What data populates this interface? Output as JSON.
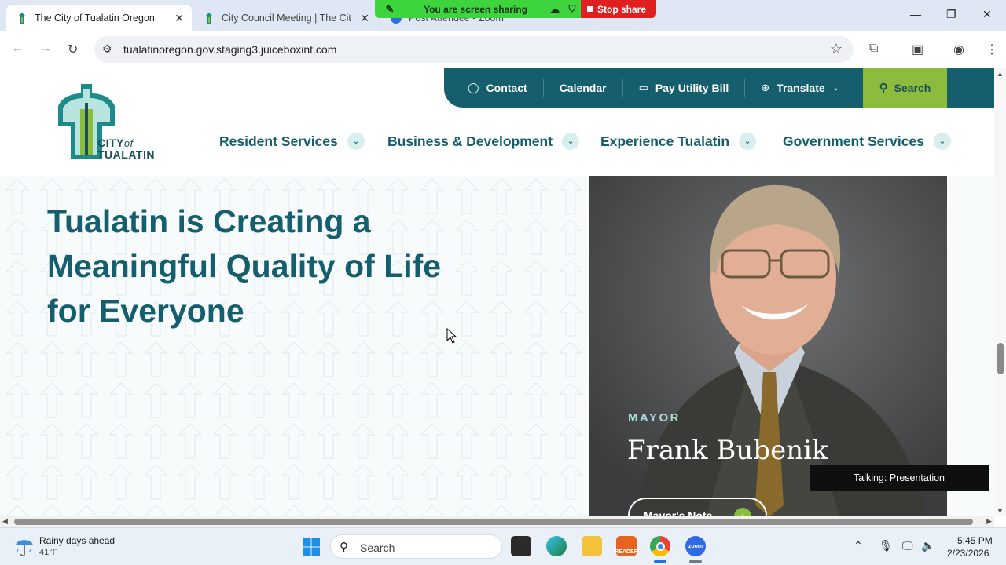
{
  "browser": {
    "tabs": [
      {
        "label": "The City of Tualatin Oregon",
        "active": true
      },
      {
        "label": "City Council Meeting | The City",
        "active": false
      },
      {
        "label": "Post Attendee - Zoom",
        "active": false
      }
    ],
    "url": "tualatinoregon.gov.staging3.juiceboxint.com",
    "icons": {
      "back": "back-arrow-icon",
      "forward": "forward-arrow-icon",
      "reload": "reload-icon",
      "star": "star-icon",
      "extensions": "puzzle-icon",
      "profile": "profile-icon",
      "menu": "kebab-menu-icon"
    }
  },
  "screen_share": {
    "status": "You are screen sharing",
    "stop_label": "Stop share"
  },
  "site": {
    "utility_nav": [
      {
        "label": "Contact",
        "icon": "chat-bubble-icon"
      },
      {
        "label": "Calendar",
        "icon": ""
      },
      {
        "label": "Pay Utility Bill",
        "icon": "credit-card-icon"
      },
      {
        "label": "Translate",
        "icon": "globe-icon"
      }
    ],
    "search_label": "Search",
    "logo": {
      "city": "CITY",
      "of": "of",
      "name": "TUALATIN"
    },
    "main_nav": [
      {
        "label": "Resident Services"
      },
      {
        "label": "Business & Development"
      },
      {
        "label": "Experience Tualatin"
      },
      {
        "label": "Government Services"
      }
    ],
    "hero": {
      "title": "Tualatin is Creating a Meaningful Quality of Life for Everyone",
      "mayor_label": "MAYOR",
      "mayor_name": "Frank Bubenik",
      "mayor_button": "Mayor's Note"
    },
    "colors": {
      "teal": "#155e6e",
      "green": "#8dbb3c",
      "light_teal": "#a9dcdc"
    }
  },
  "zoom_overlay": {
    "talking": "Talking: Presentation"
  },
  "taskbar": {
    "weather_title": "Rainy days ahead",
    "weather_temp": "41°F",
    "search_placeholder": "Search",
    "apps": [
      "windows-start-icon",
      "task-view-icon",
      "edge-icon",
      "file-explorer-icon",
      "reader-icon",
      "chrome-icon",
      "zoom-icon"
    ],
    "reader_label": "READER",
    "zoom_label": "zoom",
    "time": "5:45 PM",
    "date": "2/23/2026"
  }
}
